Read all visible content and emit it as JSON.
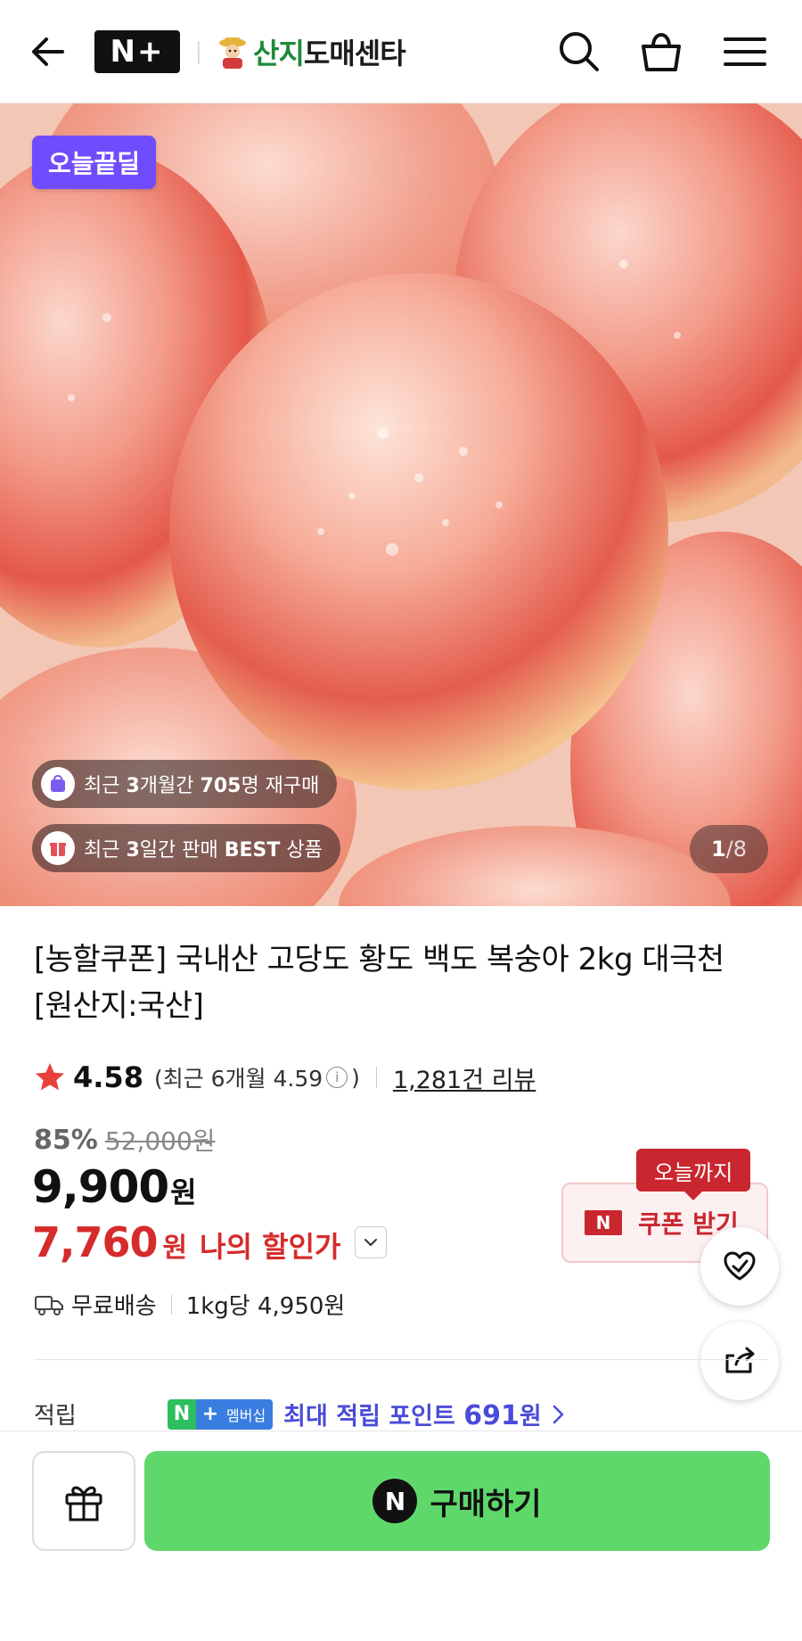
{
  "header": {
    "back_icon": "back-arrow-icon",
    "nplus_logo": "N+",
    "brand_name_green": "산지",
    "brand_name_rest": "도매센타",
    "search_icon": "search-icon",
    "cart_icon": "shopping-bag-icon",
    "menu_icon": "hamburger-menu-icon"
  },
  "hero": {
    "deal_badge": "오늘끝딜",
    "repurchase_pill": {
      "prefix": "최근 ",
      "bold1": "3",
      "mid": "개월간 ",
      "bold2": "705",
      "suffix": "명 재구매"
    },
    "best_pill": {
      "prefix": "최근 ",
      "bold1": "3",
      "mid": "일간 판매 ",
      "bold2": "BEST",
      "suffix": " 상품"
    },
    "image_counter": {
      "current": "1",
      "total": "/8"
    }
  },
  "product": {
    "title": "[농할쿠폰] 국내산 고당도 황도 백도 복숭아 2kg 대극천 [원산지:국산]",
    "rating": "4.58",
    "recent_rating_text": "(최근 6개월 4.59",
    "recent_rating_close": ")",
    "info_glyph": "i",
    "review_count": "1,281건 리뷰",
    "discount_pct": "85%",
    "original_price": "52,000원",
    "price": "9,900",
    "price_unit": "원",
    "my_price": "7,760",
    "my_price_unit": "원",
    "my_price_label": "나의 할인가",
    "shipping": "무료배송",
    "unit_price": "1kg당 4,950원"
  },
  "coupon": {
    "tag": "오늘까지",
    "n_mark": "N",
    "label": "쿠폰 받기"
  },
  "points": {
    "label": "적립",
    "badge_n": "N",
    "badge_plus": "+",
    "badge_text": "멤버십",
    "text": "최대 적립 포인트 ",
    "amount": "691",
    "unit": "원"
  },
  "bottom": {
    "gift_icon": "gift-icon",
    "buy_n": "N",
    "buy_label": "구매하기"
  },
  "colors": {
    "deal_badge": "#6f4dff",
    "sale_red": "#d62b2b",
    "coupon_red": "#c9262f",
    "buy_green": "#5fd86b",
    "point_blue": "#4a4cd9"
  }
}
